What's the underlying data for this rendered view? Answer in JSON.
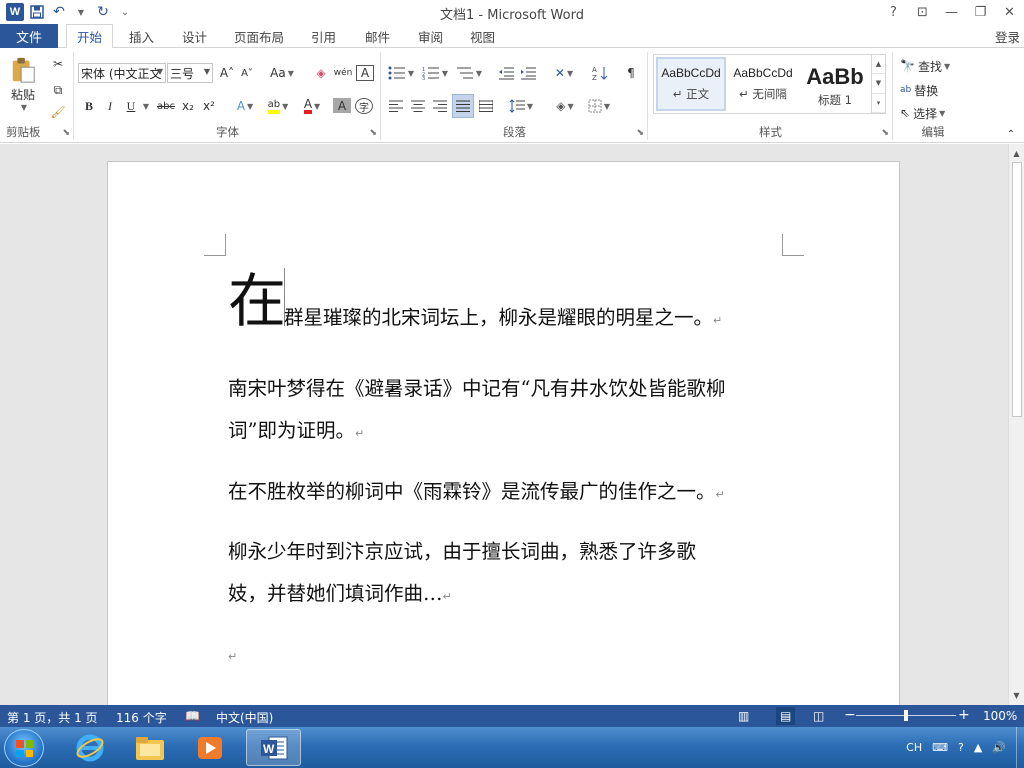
{
  "window": {
    "title": "文档1 - Microsoft Word",
    "help": "?",
    "ribbon_display": "⊡",
    "minimize": "—",
    "restore": "❐",
    "close": "✕"
  },
  "qat": {
    "logo": "W",
    "save_icon": "💾",
    "undo_icon": "↶",
    "redo_icon": "↻",
    "customize": "⌄"
  },
  "tabs": {
    "file": "文件",
    "items": [
      "开始",
      "插入",
      "设计",
      "页面布局",
      "引用",
      "邮件",
      "审阅",
      "视图"
    ],
    "login": "登录"
  },
  "ribbon": {
    "clipboard": {
      "label": "剪贴板",
      "paste": "粘贴"
    },
    "font": {
      "label": "字体",
      "font_name": "宋体 (中文正文",
      "font_size": "三号",
      "grow": "A˄",
      "shrink": "A˅",
      "case": "Aa",
      "clear": "◈",
      "phonetic": "wén",
      "border": "A",
      "bold": "B",
      "italic": "I",
      "underline": "U",
      "strike": "abc",
      "subscript": "x₂",
      "superscript": "x²",
      "effects": "A",
      "highlight": "ab",
      "font_color": "A",
      "shading": "A",
      "enclose": "字"
    },
    "paragraph": {
      "label": "段落"
    },
    "styles": {
      "label": "样式",
      "items": [
        {
          "sample": "AaBbCcDd",
          "name": "↵ 正文"
        },
        {
          "sample": "AaBbCcDd",
          "name": "↵ 无间隔"
        },
        {
          "sample": "AaBb",
          "name": "标题 1"
        }
      ]
    },
    "editing": {
      "label": "编辑",
      "find": "查找",
      "replace": "替换",
      "select": "选择"
    }
  },
  "document": {
    "dropcap": "在",
    "p1": "群星璀璨的北宋词坛上，柳永是耀眼的明星之一。",
    "p2_line1": "南宋叶梦得在《避暑录话》中记有“凡有井水饮处皆能歌柳",
    "p2_line2": "词”即为证明。",
    "p3": "在不胜枚举的柳词中《雨霖铃》是流传最广的佳作之一。",
    "p4_line1": "柳永少年时到汴京应试，由于擅长词曲，熟悉了许多歌",
    "p4_line2": "妓，并替她们填词作曲…",
    "para_mark": "↵"
  },
  "status": {
    "page": "第 1 页，共 1 页",
    "words": "116 个字",
    "language": "中文(中国)",
    "zoom_minus": "−",
    "zoom_plus": "+",
    "zoom": "100%",
    "zoom_level": 1.0
  },
  "taskbar": {
    "tray_lang": "CH",
    "apps": [
      "ie-icon",
      "explorer-icon",
      "media-player-icon",
      "word-icon"
    ]
  },
  "colors": {
    "accent": "#2b579a",
    "taskbar": "#2c6db5"
  }
}
